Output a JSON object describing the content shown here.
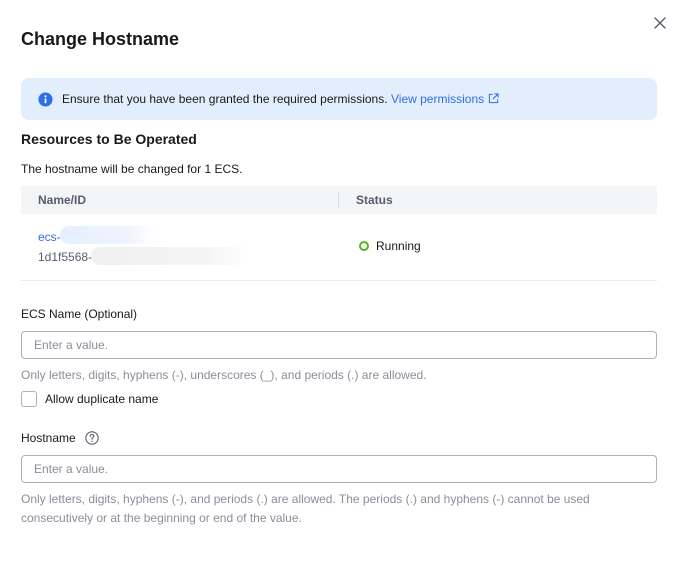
{
  "dialog": {
    "title": "Change Hostname",
    "close_icon": "close-icon"
  },
  "alert": {
    "icon": "info-icon",
    "text": "Ensure that you have been granted the required permissions.",
    "link_text": "View permissions",
    "link_icon": "external-link-icon"
  },
  "resources": {
    "title": "Resources to Be Operated",
    "description": "The hostname will be changed for 1 ECS.",
    "columns": [
      "Name/ID",
      "Status"
    ],
    "rows": [
      {
        "name": "ecs-",
        "id": "1d1f5568-",
        "status": "Running",
        "status_color": "#5ab41e"
      }
    ]
  },
  "ecs_name": {
    "label": "ECS Name (Optional)",
    "placeholder": "Enter a value.",
    "hint": "Only letters, digits, hyphens (-), underscores (_), and periods (.) are allowed.",
    "checkbox_label": "Allow duplicate name"
  },
  "hostname": {
    "label": "Hostname",
    "help_icon": "help-icon",
    "placeholder": "Enter a value.",
    "hint": "Only letters, digits, hyphens (-), and periods (.) are allowed. The periods (.) and hyphens (-) cannot be used consecutively or at the beginning or end of the value."
  },
  "colors": {
    "accent": "#2e6ee6",
    "alert_bg": "#e2eefc",
    "success": "#5ab41e"
  }
}
